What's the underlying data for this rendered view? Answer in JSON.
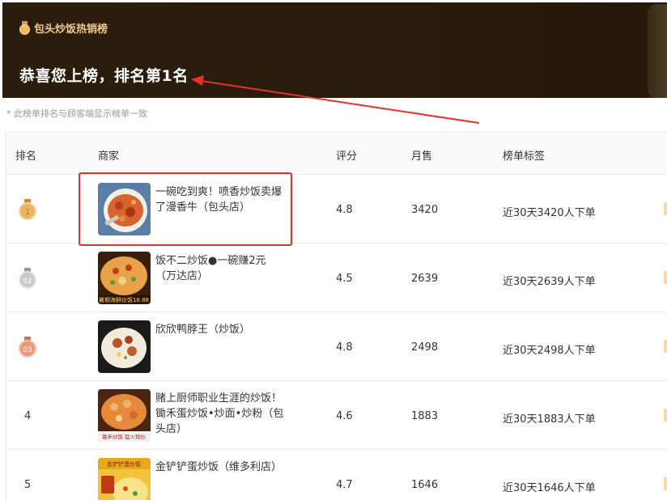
{
  "banner": {
    "brand": "包头炒饭热销榜",
    "title": "恭喜您上榜，排名第1名"
  },
  "notice": "* 此榜单排名与顾客端显示榜单一致",
  "headers": {
    "rank": "排名",
    "merchant": "商家",
    "score": "评分",
    "sales": "月售",
    "tag": "榜单标签"
  },
  "rows": [
    {
      "rank": "1",
      "name": "一碗吃到爽！喷香炒饭卖爆了漫香牛（包头店）",
      "score": "4.8",
      "sales": "3420",
      "tag": "近30天3420人下单",
      "medal": "gold"
    },
    {
      "rank": "02",
      "name": "饭不二炒饭●一碗赚2元（万达店）",
      "score": "4.5",
      "sales": "2639",
      "tag": "近30天2639人下单",
      "medal": "silver",
      "thumb_caption": "暑期海鲜炒饭18.88"
    },
    {
      "rank": "03",
      "name": "欣欣鸭脖王（炒饭）",
      "score": "4.8",
      "sales": "2498",
      "tag": "近30天2498人下单",
      "medal": "bronze"
    },
    {
      "rank": "4",
      "name": "赌上厨师职业生涯的炒饭！锄禾蛋炒饭•炒面•炒粉（包头店）",
      "score": "4.6",
      "sales": "1883",
      "tag": "近30天1883人下单",
      "medal": "",
      "thumb_caption": "锄禾炒饭 猛火现炒"
    },
    {
      "rank": "5",
      "name": "金铲铲蛋炒饭（维多利店）",
      "score": "4.7",
      "sales": "1646",
      "tag": "近30天1646人下单",
      "medal": "",
      "thumb_caption": "金铲铲蛋炒饭"
    }
  ],
  "colors": {
    "banner_bg": "#2b1d0e",
    "brand_gold": "#f2c98b",
    "annotation_red": "#e8302c"
  }
}
